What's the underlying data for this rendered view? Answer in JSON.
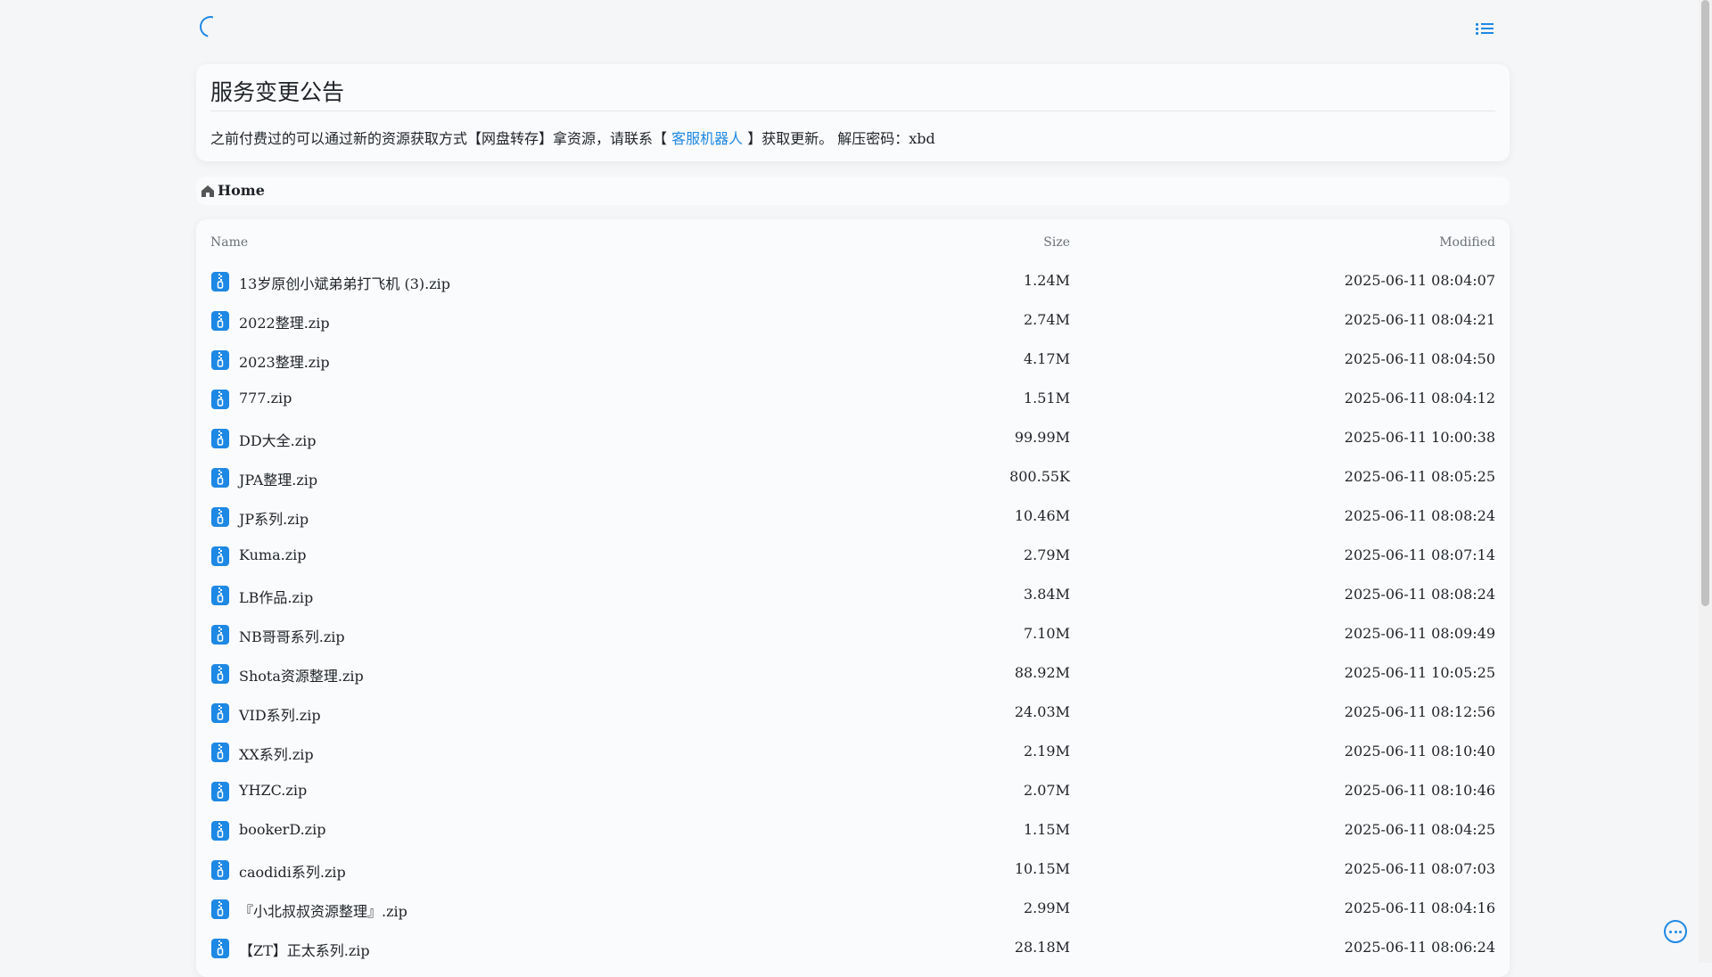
{
  "colors": {
    "accent": "#1e88e5",
    "background": "#f5f6f8",
    "card": "#fafbfc"
  },
  "icons": {
    "loading": "loading-spinner-icon",
    "menu": "list-icon",
    "breadcrumb": "home-icon",
    "file": "zip-file-icon",
    "more": "more-icon"
  },
  "notice": {
    "title": "服务变更公告",
    "body_before": "之前付费过的可以通过新的资源获取方式【网盘转存】拿资源，请联系【 ",
    "link": "客服机器人",
    "body_after": " 】获取更新。 解压密码：xbd"
  },
  "breadcrumb": {
    "label": "Home"
  },
  "table": {
    "headers": {
      "name": "Name",
      "size": "Size",
      "modified": "Modified"
    },
    "rows": [
      {
        "name": "13岁原创小斌弟弟打飞机 (3).zip",
        "size": "1.24M",
        "modified": "2025-06-11 08:04:07"
      },
      {
        "name": "2022整理.zip",
        "size": "2.74M",
        "modified": "2025-06-11 08:04:21"
      },
      {
        "name": "2023整理.zip",
        "size": "4.17M",
        "modified": "2025-06-11 08:04:50"
      },
      {
        "name": "777.zip",
        "size": "1.51M",
        "modified": "2025-06-11 08:04:12"
      },
      {
        "name": "DD大全.zip",
        "size": "99.99M",
        "modified": "2025-06-11 10:00:38"
      },
      {
        "name": "JPA整理.zip",
        "size": "800.55K",
        "modified": "2025-06-11 08:05:25"
      },
      {
        "name": "JP系列.zip",
        "size": "10.46M",
        "modified": "2025-06-11 08:08:24"
      },
      {
        "name": "Kuma.zip",
        "size": "2.79M",
        "modified": "2025-06-11 08:07:14"
      },
      {
        "name": "LB作品.zip",
        "size": "3.84M",
        "modified": "2025-06-11 08:08:24"
      },
      {
        "name": "NB哥哥系列.zip",
        "size": "7.10M",
        "modified": "2025-06-11 08:09:49"
      },
      {
        "name": "Shota资源整理.zip",
        "size": "88.92M",
        "modified": "2025-06-11 10:05:25"
      },
      {
        "name": "VID系列.zip",
        "size": "24.03M",
        "modified": "2025-06-11 08:12:56"
      },
      {
        "name": "XX系列.zip",
        "size": "2.19M",
        "modified": "2025-06-11 08:10:40"
      },
      {
        "name": "YHZC.zip",
        "size": "2.07M",
        "modified": "2025-06-11 08:10:46"
      },
      {
        "name": "bookerD.zip",
        "size": "1.15M",
        "modified": "2025-06-11 08:04:25"
      },
      {
        "name": "caodidi系列.zip",
        "size": "10.15M",
        "modified": "2025-06-11 08:07:03"
      },
      {
        "name": "『小北叔叔资源整理』.zip",
        "size": "2.99M",
        "modified": "2025-06-11 08:04:16"
      },
      {
        "name": "【ZT】正太系列.zip",
        "size": "28.18M",
        "modified": "2025-06-11 08:06:24"
      }
    ]
  }
}
